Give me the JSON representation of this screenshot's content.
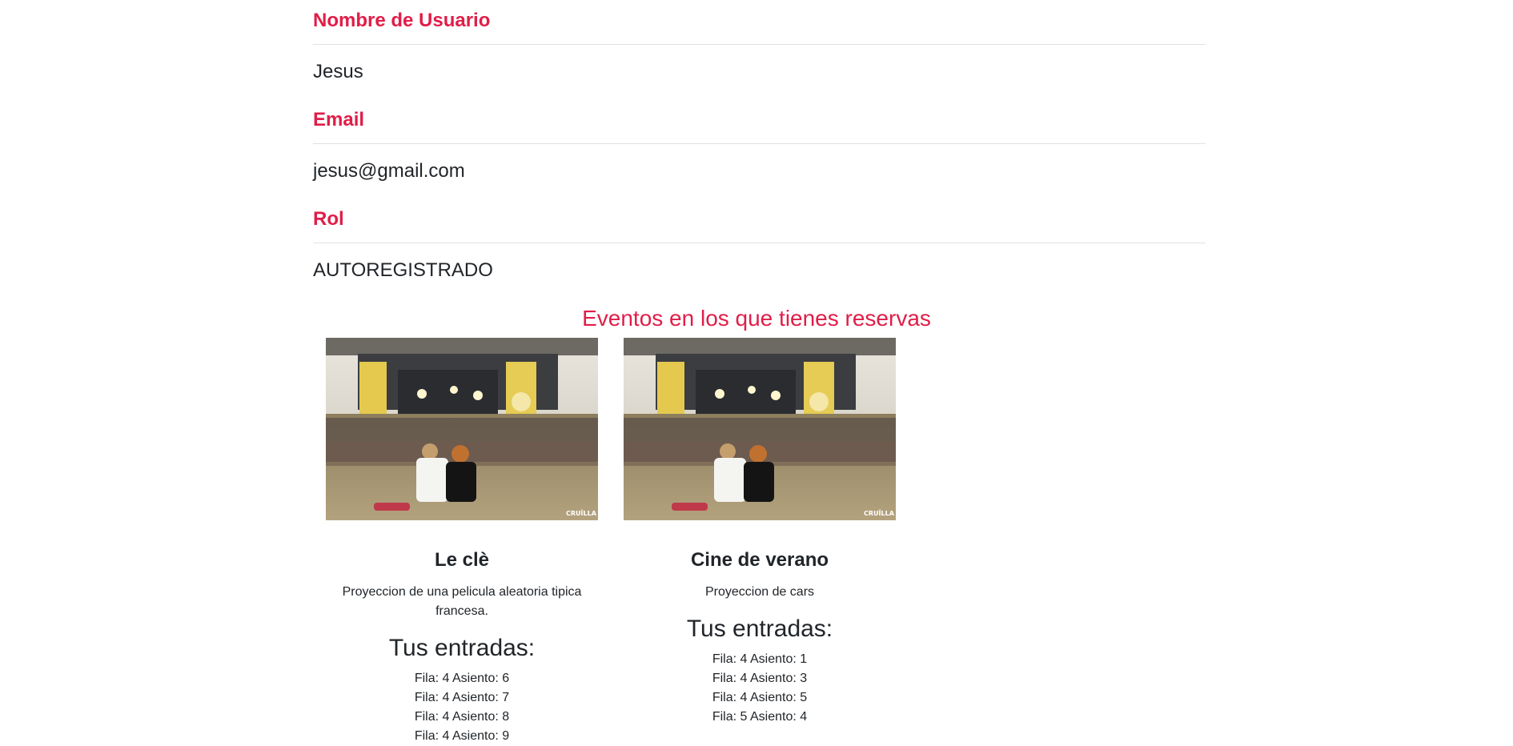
{
  "profile": {
    "fields": [
      {
        "label": "Nombre de Usuario",
        "value": "Jesus"
      },
      {
        "label": "Email",
        "value": "jesus@gmail.com"
      },
      {
        "label": "Rol",
        "value": "AUTOREGISTRADO"
      }
    ]
  },
  "events_section": {
    "title": "Eventos en los que tienes reservas",
    "tickets_heading": "Tus entradas:",
    "events": [
      {
        "title": "Le clè",
        "description": "Proyeccion de una pelicula aleatoria tipica francesa.",
        "image_label": "CRUÏLLA",
        "tickets": [
          "Fila: 4 Asiento: 6",
          "Fila: 4 Asiento: 7",
          "Fila: 4 Asiento: 8",
          "Fila: 4 Asiento: 9"
        ]
      },
      {
        "title": "Cine de verano",
        "description": "Proyeccion de cars",
        "image_label": "CRUÏLLA",
        "tickets": [
          "Fila: 4 Asiento: 1",
          "Fila: 4 Asiento: 3",
          "Fila: 4 Asiento: 5",
          "Fila: 5 Asiento: 4"
        ]
      }
    ]
  },
  "colors": {
    "accent": "#e11d48",
    "text": "#212529",
    "divider": "#dee2e6"
  }
}
